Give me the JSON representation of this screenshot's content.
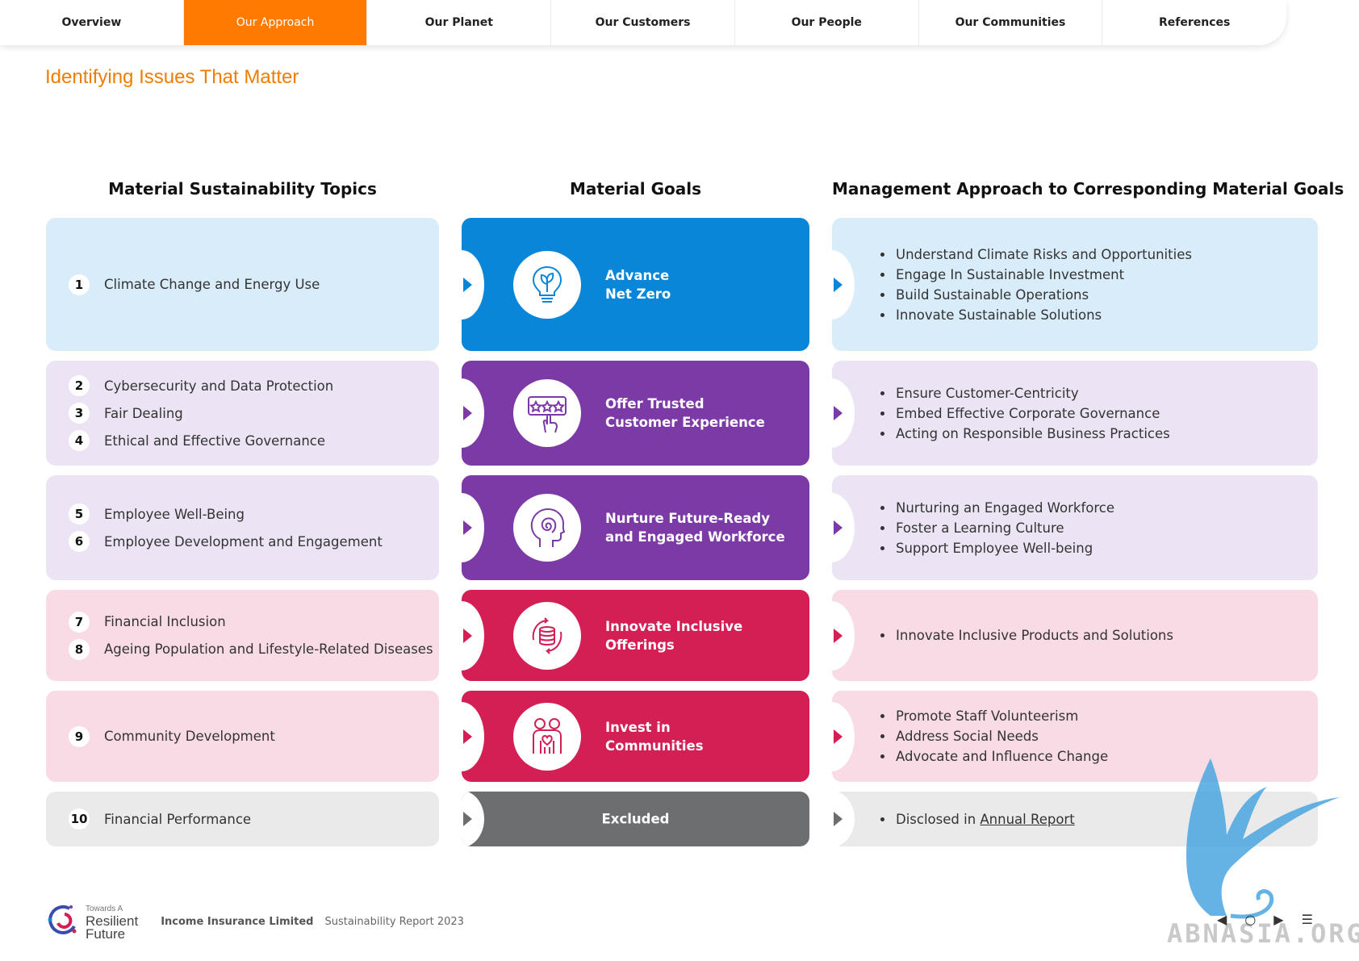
{
  "nav": {
    "tabs": [
      {
        "label": "Overview"
      },
      {
        "label": "Our Approach"
      },
      {
        "label": "Our Planet"
      },
      {
        "label": "Our Customers"
      },
      {
        "label": "Our People"
      },
      {
        "label": "Our Communities"
      },
      {
        "label": "References"
      }
    ],
    "active_tab": "Our Approach"
  },
  "page_title": "Identifying Issues That Matter",
  "columns": {
    "topics": "Material Sustainability Topics",
    "goals": "Material Goals",
    "approach": "Management Approach to Corresponding Material Goals"
  },
  "rows": [
    {
      "topics": [
        {
          "num": "1",
          "text": "Climate Change and Energy Use"
        }
      ],
      "goal": "Advance\nNet Zero",
      "goal_icon": "lightbulb-leaf-icon",
      "approach": [
        "Understand Climate Risks and Opportunities",
        "Engage In Sustainable Investment",
        "Build Sustainable Operations",
        "Innovate Sustainable Solutions"
      ]
    },
    {
      "topics": [
        {
          "num": "2",
          "text": "Cybersecurity and Data Protection"
        },
        {
          "num": "3",
          "text": "Fair Dealing"
        },
        {
          "num": "4",
          "text": "Ethical and Effective Governance"
        }
      ],
      "goal": "Offer Trusted\nCustomer Experience",
      "goal_icon": "rating-stars-icon",
      "approach": [
        "Ensure Customer-Centricity",
        "Embed Effective Corporate Governance",
        "Acting on Responsible Business Practices"
      ]
    },
    {
      "topics": [
        {
          "num": "5",
          "text": "Employee Well-Being"
        },
        {
          "num": "6",
          "text": "Employee Development and Engagement"
        }
      ],
      "goal": "Nurture Future-Ready\nand Engaged Workforce",
      "goal_icon": "head-spiral-icon",
      "approach": [
        "Nurturing an Engaged Workforce",
        "Foster a Learning Culture",
        "Support Employee Well-being"
      ]
    },
    {
      "topics": [
        {
          "num": "7",
          "text": "Financial Inclusion"
        },
        {
          "num": "8",
          "text": "Ageing Population and Lifestyle-Related Diseases"
        }
      ],
      "goal": "Innovate Inclusive\nOfferings",
      "goal_icon": "coins-cycle-icon",
      "approach": [
        "Innovate Inclusive Products and Solutions"
      ]
    },
    {
      "topics": [
        {
          "num": "9",
          "text": "Community Development"
        }
      ],
      "goal": "Invest in\nCommunities",
      "goal_icon": "people-heart-icon",
      "approach": [
        "Promote Staff Volunteerism",
        "Address Social Needs",
        "Advocate and Influence Change"
      ]
    },
    {
      "topics": [
        {
          "num": "10",
          "text": "Financial Performance"
        }
      ],
      "goal": "Excluded",
      "approach_prefix": "Disclosed in ",
      "approach_link": "Annual Report"
    }
  ],
  "footer": {
    "brand_small": "Towards A",
    "brand_line1": "Resilient",
    "brand_line2": "Future",
    "company": "Income Insurance Limited",
    "report": "Sustainability Report 2023"
  },
  "watermark": "ABNASIA.ORG",
  "colors": {
    "accent": "#ff7a00",
    "goal_blue": "#0a86d8",
    "goal_purple": "#7b3aa6",
    "goal_red": "#d31f54",
    "goal_grey": "#6d6e70"
  }
}
